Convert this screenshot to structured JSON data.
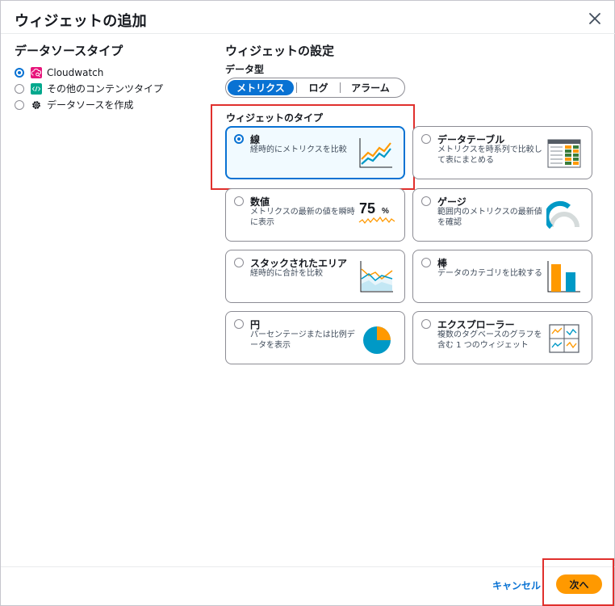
{
  "dialog": {
    "title": "ウィジェットの追加"
  },
  "datasource": {
    "title": "データソースタイプ",
    "items": [
      {
        "label": "Cloudwatch",
        "icon": "cloudwatch-icon",
        "checked": true
      },
      {
        "label": "その他のコンテンツタイプ",
        "icon": "code-icon",
        "checked": false
      },
      {
        "label": "データソースを作成",
        "icon": "gear-icon",
        "checked": false
      }
    ]
  },
  "settings": {
    "title": "ウィジェットの設定",
    "data_type_label": "データ型",
    "data_types": [
      "メトリクス",
      "ログ",
      "アラーム"
    ],
    "widget_type_label": "ウィジェットのタイプ"
  },
  "widgets": [
    {
      "title": "線",
      "desc": "経時的にメトリクスを比較",
      "selected": true,
      "icon": "line-chart-icon"
    },
    {
      "title": "データテーブル",
      "desc": "メトリクスを時系列で比較して表にまとめる",
      "selected": false,
      "icon": "table-icon"
    },
    {
      "title": "数値",
      "desc": "メトリクスの最新の値を瞬時に表示",
      "selected": false,
      "icon": "number-icon",
      "icon_text": "75",
      "icon_unit": "%"
    },
    {
      "title": "ゲージ",
      "desc": "範囲内のメトリクスの最新値を確認",
      "selected": false,
      "icon": "gauge-icon"
    },
    {
      "title": "スタックされたエリア",
      "desc": "経時的に合計を比較",
      "selected": false,
      "icon": "stacked-area-icon"
    },
    {
      "title": "棒",
      "desc": "データのカテゴリを比較する",
      "selected": false,
      "icon": "bar-chart-icon"
    },
    {
      "title": "円",
      "desc": "パーセンテージまたは比例データを表示",
      "selected": false,
      "icon": "pie-chart-icon"
    },
    {
      "title": "エクスプローラー",
      "desc": "複数のタグベースのグラフを含む 1 つのウィジェット",
      "selected": false,
      "icon": "explorer-icon"
    }
  ],
  "footer": {
    "cancel_label": "キャンセル",
    "next_label": "次へ"
  },
  "colors": {
    "accent": "#0972d3",
    "primary_button": "#ff9900",
    "highlight": "#e0302d",
    "chart_orange": "#ff9900",
    "chart_teal": "#0099c6"
  }
}
